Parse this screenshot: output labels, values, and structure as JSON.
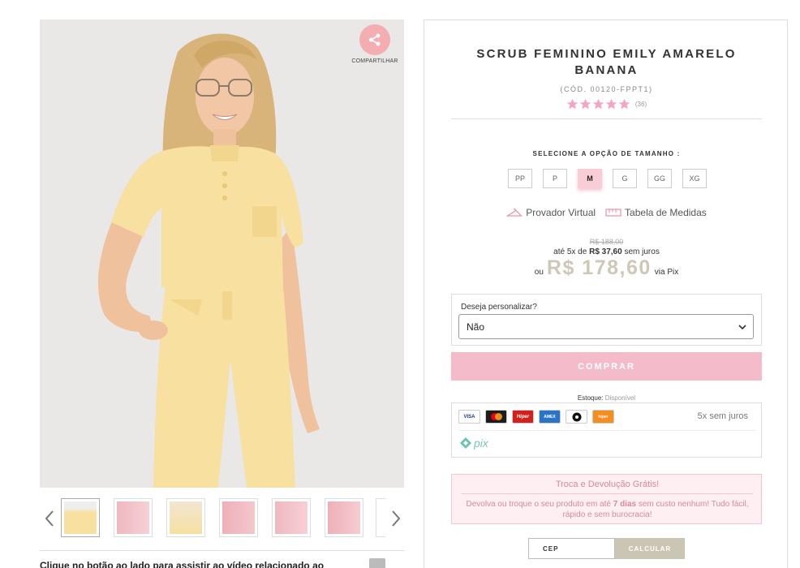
{
  "share": {
    "label": "COMPARTILHAR"
  },
  "product": {
    "title": "SCRUB FEMININO EMILY AMARELO BANANA",
    "sku": "(CÓD. 00120-FPPT1)",
    "rating_count": "(36)",
    "rating_stars": 5
  },
  "size_selector": {
    "label": "SELECIONE A OPÇÃO DE TAMANHO :",
    "options": [
      "PP",
      "P",
      "M",
      "G",
      "GG",
      "XG"
    ],
    "selected": "M"
  },
  "tools": {
    "virtual_fitting": "Provador Virtual",
    "size_chart": "Tabela de Medidas"
  },
  "pricing": {
    "old_price": "R$ 188,00",
    "installments_prefix": "até 5x de",
    "installments_value": "R$ 37,60",
    "installments_suffix": "sem juros",
    "pix_prefix": "ou",
    "pix_price": "R$ 178,60",
    "pix_suffix": "via Pix"
  },
  "customize": {
    "label": "Deseja personalizar?",
    "selected_value": "Não"
  },
  "buy_button": "COMPRAR",
  "stock": {
    "label": "Estoque:",
    "value": "Disponível"
  },
  "payments": {
    "installments_note": "5x sem juros",
    "pix_label": "pix"
  },
  "returns": {
    "title": "Troca e Devolução Grátis!",
    "text_before": "Devolva ou troque o seu produto em até",
    "text_bold": "7 dias",
    "text_after": "sem custo nenhum! Tudo fácil, rápido e sem burocracia!"
  },
  "shipping": {
    "cep_placeholder": "CEP",
    "calculate_label": "CALCULAR"
  },
  "video_prompt": "Clique no botão ao lado para assistir ao vídeo relacionado ao",
  "colors": {
    "accent_pink": "#f4bccb",
    "product_yellow": "#f7e0a0",
    "price_beige": "#cfc7b8"
  }
}
